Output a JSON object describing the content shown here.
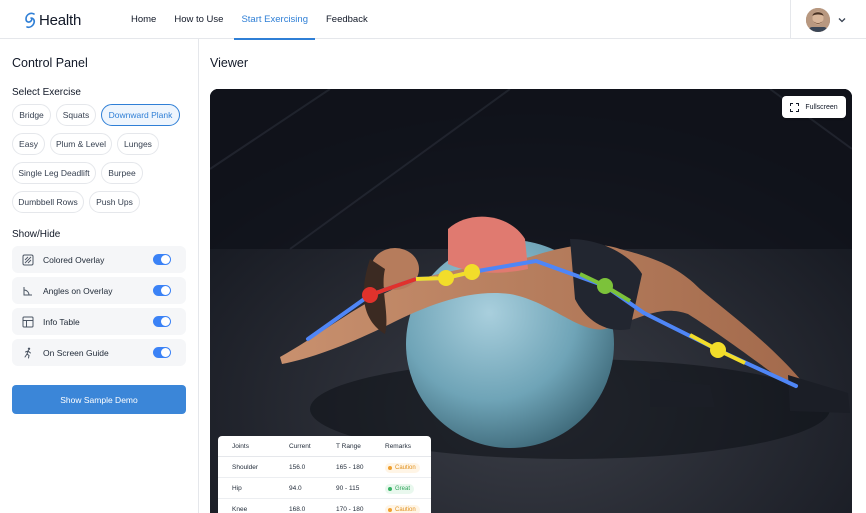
{
  "app": {
    "logo_text": "Health"
  },
  "nav": {
    "items": [
      "Home",
      "How to Use",
      "Start Exercising",
      "Feedback"
    ],
    "active": "Start Exercising"
  },
  "sidebar": {
    "title": "Control Panel",
    "select_label": "Select Exercise",
    "exercises": [
      "Bridge",
      "Squats",
      "Downward Plank",
      "Easy",
      "Plum & Level",
      "Lunges",
      "Single Leg Deadlift",
      "Burpee",
      "Dumbbell Rows",
      "Push Ups"
    ],
    "selected_exercise": "Downward Plank",
    "show_hide_label": "Show/Hide",
    "toggles": [
      {
        "label": "Colored Overlay",
        "icon": "overlay-icon",
        "on": true
      },
      {
        "label": "Angles on Overlay",
        "icon": "angle-icon",
        "on": true
      },
      {
        "label": "Info Table",
        "icon": "table-icon",
        "on": true
      },
      {
        "label": "On Screen Guide",
        "icon": "runner-icon",
        "on": true
      }
    ],
    "demo_button": "Show Sample Demo"
  },
  "viewer": {
    "title": "Viewer",
    "fullscreen_label": "Fullscreen",
    "table": {
      "headers": [
        "Joints",
        "Current",
        "T Range",
        "Remarks"
      ],
      "rows": [
        {
          "joint": "Shoulder",
          "current": "156.0",
          "range": "165 - 180",
          "remark": "Caution",
          "status": "caution"
        },
        {
          "joint": "Hip",
          "current": "94.0",
          "range": "90 - 115",
          "remark": "Great",
          "status": "great"
        },
        {
          "joint": "Knee",
          "current": "168.0",
          "range": "170 - 180",
          "remark": "Caution",
          "status": "caution"
        }
      ]
    }
  },
  "colors": {
    "accent": "#2f7fd6",
    "button": "#3b86d8",
    "toggle": "#3b82f6",
    "joint_red": "#e0322c",
    "joint_yellow": "#f2dd2a",
    "joint_green": "#7cc23a",
    "skeleton": "#4f86f7"
  }
}
